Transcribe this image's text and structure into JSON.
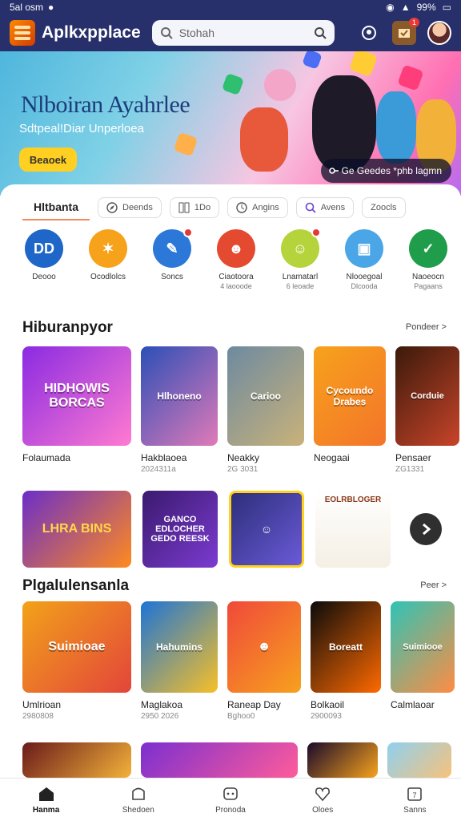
{
  "status": {
    "time": "5al  osm",
    "battery": "99%"
  },
  "header": {
    "title": "Aplkxpplace",
    "search_placeholder": "Stohah",
    "notif_count": "1"
  },
  "banner": {
    "title": "Nlboiran Ayahrlee",
    "subtitle": "Sdtpeal!Diar Unperloea",
    "button": "Beaoek",
    "pill": "Ge  Geedes  *phb lagmn"
  },
  "tabs": [
    {
      "label": "Hltbanta",
      "active": true,
      "icon": "none"
    },
    {
      "label": "Deends",
      "icon": "compass-icon"
    },
    {
      "label": "1Do",
      "icon": "grid-icon"
    },
    {
      "label": "Angins",
      "icon": "clock-icon"
    },
    {
      "label": "Avens",
      "icon": "search-icon"
    },
    {
      "label": "Zoocls",
      "icon": "none"
    }
  ],
  "categories": [
    {
      "label": "Deooo",
      "sub": "",
      "color": "#1e66c8",
      "glyph": "DD"
    },
    {
      "label": "Ocodlolcs",
      "sub": "",
      "color": "#f6a21a",
      "glyph": "✶"
    },
    {
      "label": "Soncs",
      "sub": "",
      "color": "#2b78d8",
      "glyph": "✎"
    },
    {
      "label": "Ciaotoora",
      "sub": "4 laooode",
      "color": "#e44a2f",
      "glyph": "☻"
    },
    {
      "label": "Lnamatarl",
      "sub": "6 leoade",
      "color": "#b5d33a",
      "glyph": "☺"
    },
    {
      "label": "Nlooegoal",
      "sub": "Dlcooda",
      "color": "#4aa6e6",
      "glyph": "▣"
    },
    {
      "label": "Naoeocn",
      "sub": "Pagaans",
      "color": "#1f9d4a",
      "glyph": "✓"
    }
  ],
  "section1": {
    "title": "Hiburanpyor",
    "more": "Pondeer >"
  },
  "section1_cards": [
    {
      "name": "Folaumada",
      "meta": "",
      "art": "HIDHOWIS BORCAS",
      "bg": "linear-gradient(135deg,#8a2be2,#ff7ad1)"
    },
    {
      "name": "Hakblaoea",
      "meta": "2024311a",
      "art": "Hlhoneno",
      "bg": "linear-gradient(135deg,#2b4fb7,#e07ab8)"
    },
    {
      "name": "Neakky",
      "meta": "2G 3031",
      "art": "Carioo",
      "bg": "linear-gradient(135deg,#6d8aa0,#c9b27a)"
    },
    {
      "name": "Neogaai",
      "meta": "",
      "art": "Cycoundo Drabes",
      "bg": "linear-gradient(135deg,#f7a21c,#f3742a)"
    },
    {
      "name": "Pensaer",
      "meta": "ZG1331",
      "art": "Corduie",
      "bg": "linear-gradient(135deg,#3a1a0a,#c8442a)"
    }
  ],
  "row2": [
    {
      "art": "LHRA BINS",
      "bg": "linear-gradient(135deg,#6b2ec8,#ff8a1e)"
    },
    {
      "art": "GANCO EDLOCHER GEDO REESK",
      "bg": "linear-gradient(135deg,#3a1a6e,#7c3bd1)"
    },
    {
      "art": "",
      "bg": "linear-gradient(135deg,#2d2f7a,#ffd11a)"
    },
    {
      "art": "EOLRBLOGER",
      "bg": "linear-gradient(135deg,#f7f7f7,#f2d17a)"
    }
  ],
  "section2": {
    "title": "Plgalulensanla",
    "more": "Peer >"
  },
  "section2_cards": [
    {
      "name": "Umlrioan",
      "meta": "2980808",
      "art": "Suimioae",
      "bg": "linear-gradient(135deg,#f2a21a,#e3453a)"
    },
    {
      "name": "Maglakoa",
      "meta": "2950 2026",
      "art": "Hahumins",
      "bg": "linear-gradient(135deg,#1d74d6,#f7c027)"
    },
    {
      "name": "Raneap Day",
      "meta": "Bghoo0",
      "art": "",
      "bg": "linear-gradient(135deg,#f0493a,#f7a11e)"
    },
    {
      "name": "Bolkaoil",
      "meta": "2900093",
      "art": "Boreatt",
      "bg": "linear-gradient(135deg,#0b0b0b,#ff6a00)"
    },
    {
      "name": "Calmlaoar",
      "meta": "",
      "art": "Suimiooe",
      "bg": "linear-gradient(135deg,#2ec4b6,#ff8c42)"
    }
  ],
  "nav": [
    {
      "label": "Hanma",
      "icon": "home-icon",
      "active": true
    },
    {
      "label": "Shedoen",
      "icon": "shop-icon"
    },
    {
      "label": "Pronoda",
      "icon": "gamepad-icon"
    },
    {
      "label": "Oloes",
      "icon": "heart-icon"
    },
    {
      "label": "Sanns",
      "icon": "calendar-icon"
    }
  ],
  "colors": {
    "header": "#27306b",
    "accent": "#ffd021"
  }
}
